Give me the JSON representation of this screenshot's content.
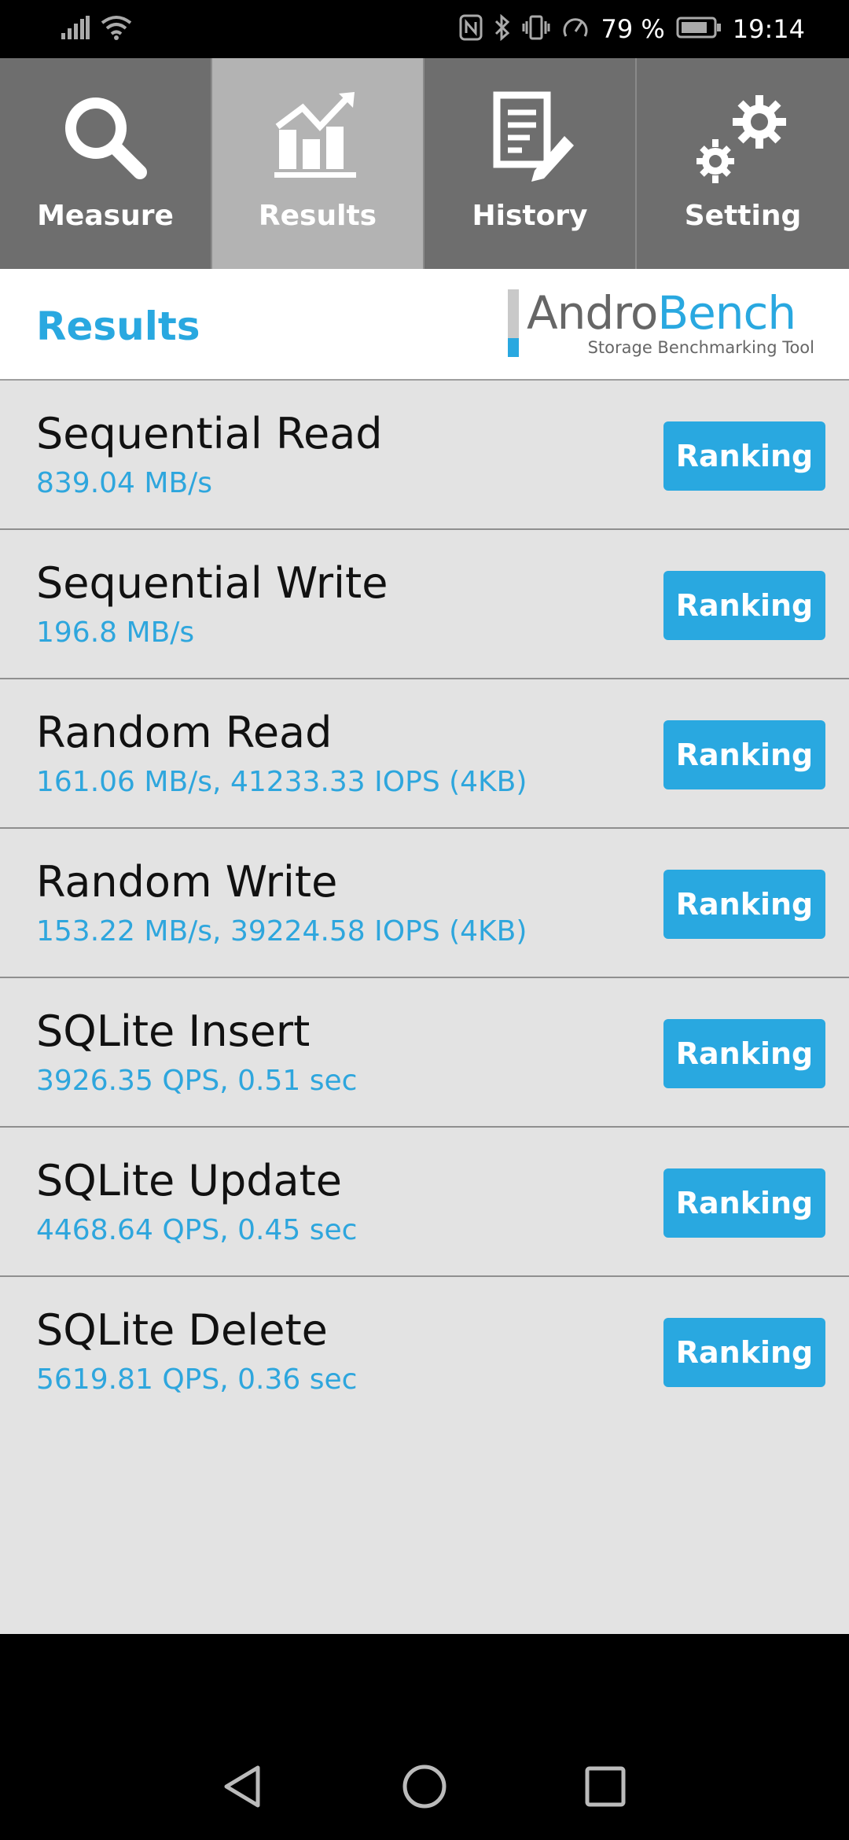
{
  "status_bar": {
    "battery_percent": "79 %",
    "time": "19:14"
  },
  "tabs": [
    {
      "label": "Measure",
      "icon": "magnifier-icon",
      "active": false
    },
    {
      "label": "Results",
      "icon": "chart-icon",
      "active": true
    },
    {
      "label": "History",
      "icon": "document-pencil-icon",
      "active": false
    },
    {
      "label": "Setting",
      "icon": "gears-icon",
      "active": false
    }
  ],
  "header": {
    "title": "Results",
    "logo_part1": "Andro",
    "logo_part2": "Bench",
    "logo_tagline": "Storage Benchmarking Tool"
  },
  "results": [
    {
      "name": "Sequential Read",
      "value": "839.04 MB/s",
      "button": "Ranking"
    },
    {
      "name": "Sequential Write",
      "value": "196.8 MB/s",
      "button": "Ranking"
    },
    {
      "name": "Random Read",
      "value": "161.06 MB/s, 41233.33 IOPS (4KB)",
      "button": "Ranking"
    },
    {
      "name": "Random Write",
      "value": "153.22 MB/s, 39224.58 IOPS (4KB)",
      "button": "Ranking"
    },
    {
      "name": "SQLite Insert",
      "value": "3926.35 QPS, 0.51 sec",
      "button": "Ranking"
    },
    {
      "name": "SQLite Update",
      "value": "4468.64 QPS, 0.45 sec",
      "button": "Ranking"
    },
    {
      "name": "SQLite Delete",
      "value": "5619.81 QPS, 0.36 sec",
      "button": "Ranking"
    }
  ],
  "colors": {
    "accent": "#29a8e0",
    "tab_bg": "#6e6e6e",
    "tab_active_bg": "#b3b3b3",
    "list_bg": "#e3e3e3"
  }
}
